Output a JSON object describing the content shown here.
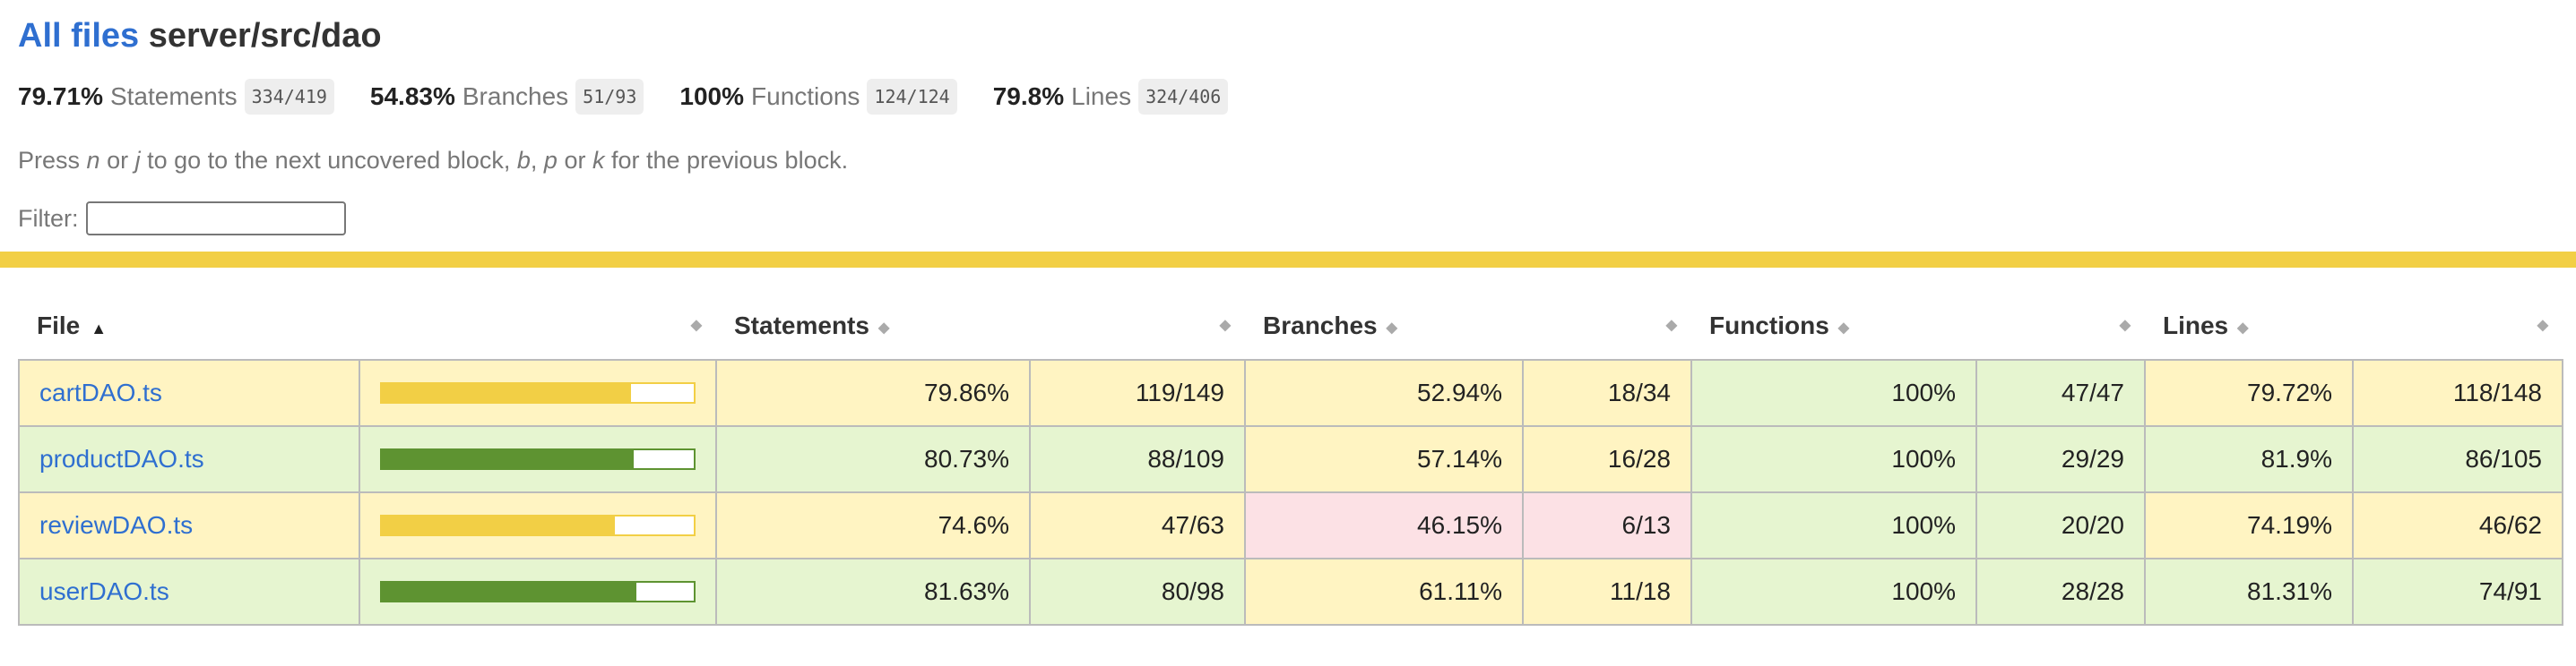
{
  "header": {
    "all_files": "All files",
    "path": "server/src/dao"
  },
  "summary": [
    {
      "pct": "79.71%",
      "label": "Statements",
      "fraction": "334/419"
    },
    {
      "pct": "54.83%",
      "label": "Branches",
      "fraction": "51/93"
    },
    {
      "pct": "100%",
      "label": "Functions",
      "fraction": "124/124"
    },
    {
      "pct": "79.8%",
      "label": "Lines",
      "fraction": "324/406"
    }
  ],
  "hint": {
    "p1": "Press ",
    "n": "n",
    "p2": " or ",
    "j": "j",
    "p3": " to go to the next uncovered block, ",
    "b": "b",
    "p4": ", ",
    "p": "p",
    "p5": " or ",
    "k": "k",
    "p6": " for the previous block."
  },
  "filter": {
    "label": "Filter:",
    "value": ""
  },
  "columns": {
    "file": "File",
    "statements": "Statements",
    "branches": "Branches",
    "functions": "Functions",
    "lines": "Lines"
  },
  "colors": {
    "medium_fill": "#f2cf45",
    "high_fill": "#5e9331",
    "medium_bg": "#fff4c2",
    "high_bg": "#e6f5d0",
    "low_bg": "#fce1e5"
  },
  "rows": [
    {
      "file": "cartDAO.ts",
      "level": "medium",
      "coverage": 0.7986,
      "stmt_pct": "79.86%",
      "stmt_frac": "119/149",
      "br_pct": "52.94%",
      "br_frac": "18/34",
      "br_level": "medium",
      "fn_pct": "100%",
      "fn_frac": "47/47",
      "ln_pct": "79.72%",
      "ln_frac": "118/148"
    },
    {
      "file": "productDAO.ts",
      "level": "high",
      "coverage": 0.8073,
      "stmt_pct": "80.73%",
      "stmt_frac": "88/109",
      "br_pct": "57.14%",
      "br_frac": "16/28",
      "br_level": "medium",
      "fn_pct": "100%",
      "fn_frac": "29/29",
      "ln_pct": "81.9%",
      "ln_frac": "86/105"
    },
    {
      "file": "reviewDAO.ts",
      "level": "medium",
      "coverage": 0.746,
      "stmt_pct": "74.6%",
      "stmt_frac": "47/63",
      "br_pct": "46.15%",
      "br_frac": "6/13",
      "br_level": "low",
      "fn_pct": "100%",
      "fn_frac": "20/20",
      "ln_pct": "74.19%",
      "ln_frac": "46/62"
    },
    {
      "file": "userDAO.ts",
      "level": "high",
      "coverage": 0.8163,
      "stmt_pct": "81.63%",
      "stmt_frac": "80/98",
      "br_pct": "61.11%",
      "br_frac": "11/18",
      "br_level": "medium",
      "fn_pct": "100%",
      "fn_frac": "28/28",
      "ln_pct": "81.31%",
      "ln_frac": "74/91"
    }
  ]
}
